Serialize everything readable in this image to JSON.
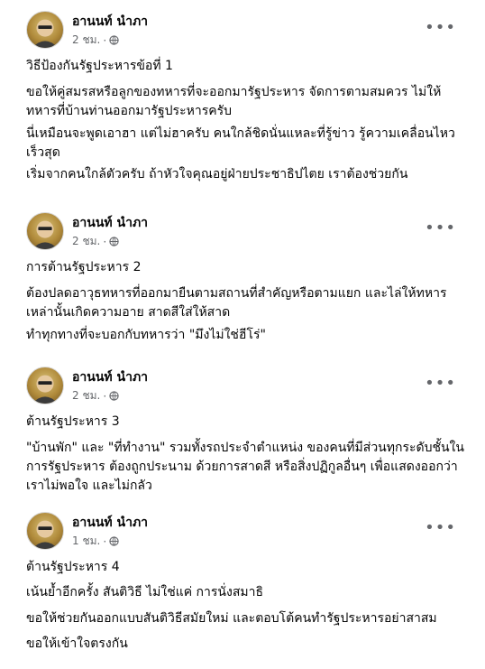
{
  "posts": [
    {
      "author": "อานนท์ นำภา",
      "time": "2 ชม.",
      "paragraphs": [
        "วิธีป้องกันรัฐประหารข้อที่ 1",
        "ขอให้คู่สมรสหรือลูกของทหารที่จะออกมารัฐประหาร จัดการตามสมควร ไม่ให้ทหารที่บ้านท่านออกมารัฐประหารครับ",
        "นี่เหมือนจะพูดเอาฮา แต่ไม่ฮาครับ คนใกล้ชิดนั่นแหละที่รู้ข่าว รู้ความเคลื่อนไหวเร็วสุด",
        "เริ่มจากคนใกล้ตัวครับ ถ้าหัวใจคุณอยู่ฝ่ายประชาธิปไตย เราต้องช่วยกัน"
      ]
    },
    {
      "author": "อานนท์ นำภา",
      "time": "2 ชม.",
      "paragraphs": [
        "การต้านรัฐประหาร 2",
        "ต้องปลดอาวุธทหารที่ออกมายืนตามสถานที่สำคัญหรือตามแยก และไล่ให้ทหารเหล่านั้นเกิดความอาย สาดสีใส่ให้สาด",
        "ทำทุกทางที่จะบอกกับทหารว่า \"มึงไม่ใช่ฮีโร่\""
      ]
    },
    {
      "author": "อานนท์ นำภา",
      "time": "2 ชม.",
      "paragraphs": [
        "ต้านรัฐประหาร 3",
        "\"บ้านพัก\" และ \"ที่ทำงาน\" รวมทั้งรถประจำตำแหน่ง ของคนที่มีส่วนทุกระดับชั้นในการรัฐประหาร ต้องถูกประนาม ด้วยการสาดสี หรือสิ่งปฏิกูลอื่นๆ เพื่อแสดงออกว่าเราไม่พอใจ และไม่กลัว"
      ]
    },
    {
      "author": "อานนท์ นำภา",
      "time": "1 ชม.",
      "paragraphs": [
        "ต้านรัฐประหาร 4",
        "เน้นย้ำอีกครั้ง สันติวิธี ไม่ใช่แค่ การนั่งสมาธิ",
        "ขอให้ช่วยกันออกแบบสันติวิธีสมัยใหม่ และตอบโต้คนทำรัฐประหารอย่าสาสม",
        "ขอให้เข้าใจตรงกัน"
      ]
    }
  ],
  "icons": {
    "privacy": "globe-icon",
    "menu": "more-options-icon"
  },
  "colors": {
    "text": "#050505",
    "secondary": "#65676b"
  }
}
